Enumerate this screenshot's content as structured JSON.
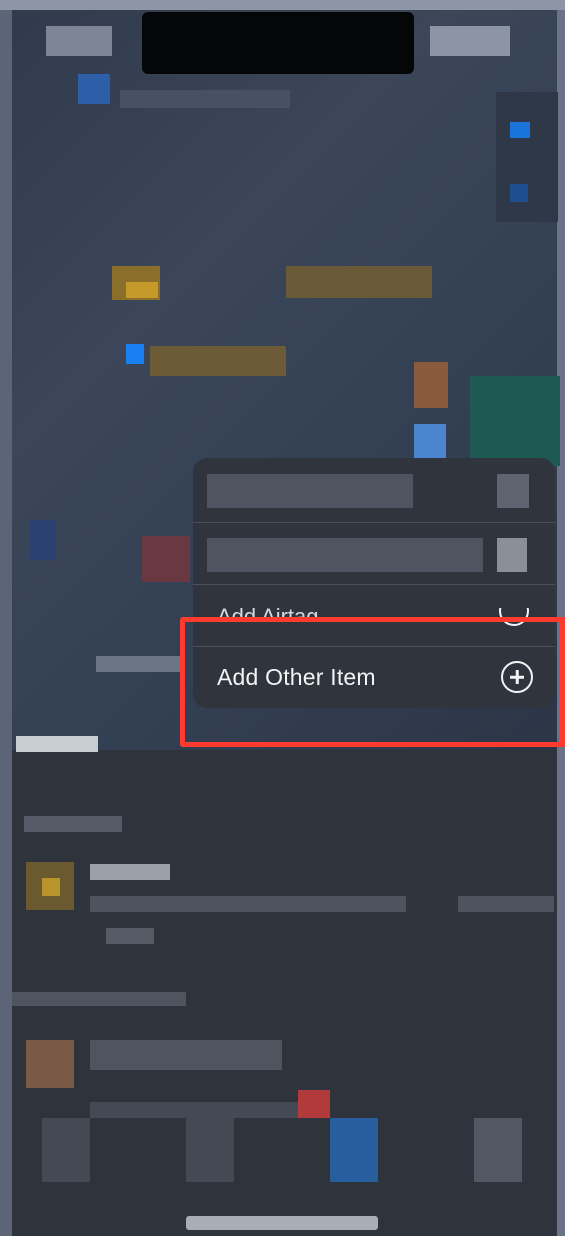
{
  "menu": {
    "partial_item_label": "Add Airtag",
    "add_other_item": {
      "label": "Add Other Item",
      "icon": "plus-circle-icon"
    }
  },
  "highlight": {
    "color": "#ff3b30"
  }
}
